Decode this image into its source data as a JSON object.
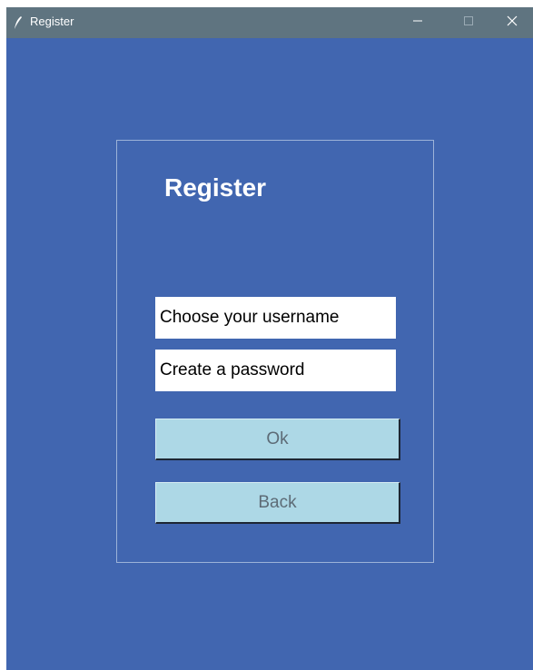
{
  "window": {
    "title": "Register",
    "controls": {
      "minimize": "—",
      "maximize": "☐",
      "close": "✕"
    },
    "colors": {
      "background": "#4166b0",
      "titlebar": "#5f7480",
      "button": "#add8e6"
    }
  },
  "form": {
    "heading": "Register",
    "username": {
      "value": "",
      "placeholder": "Choose your username"
    },
    "password": {
      "value": "",
      "placeholder": "Create a password"
    },
    "ok_label": "Ok",
    "back_label": "Back"
  },
  "icons": {
    "app": "feather-icon"
  }
}
